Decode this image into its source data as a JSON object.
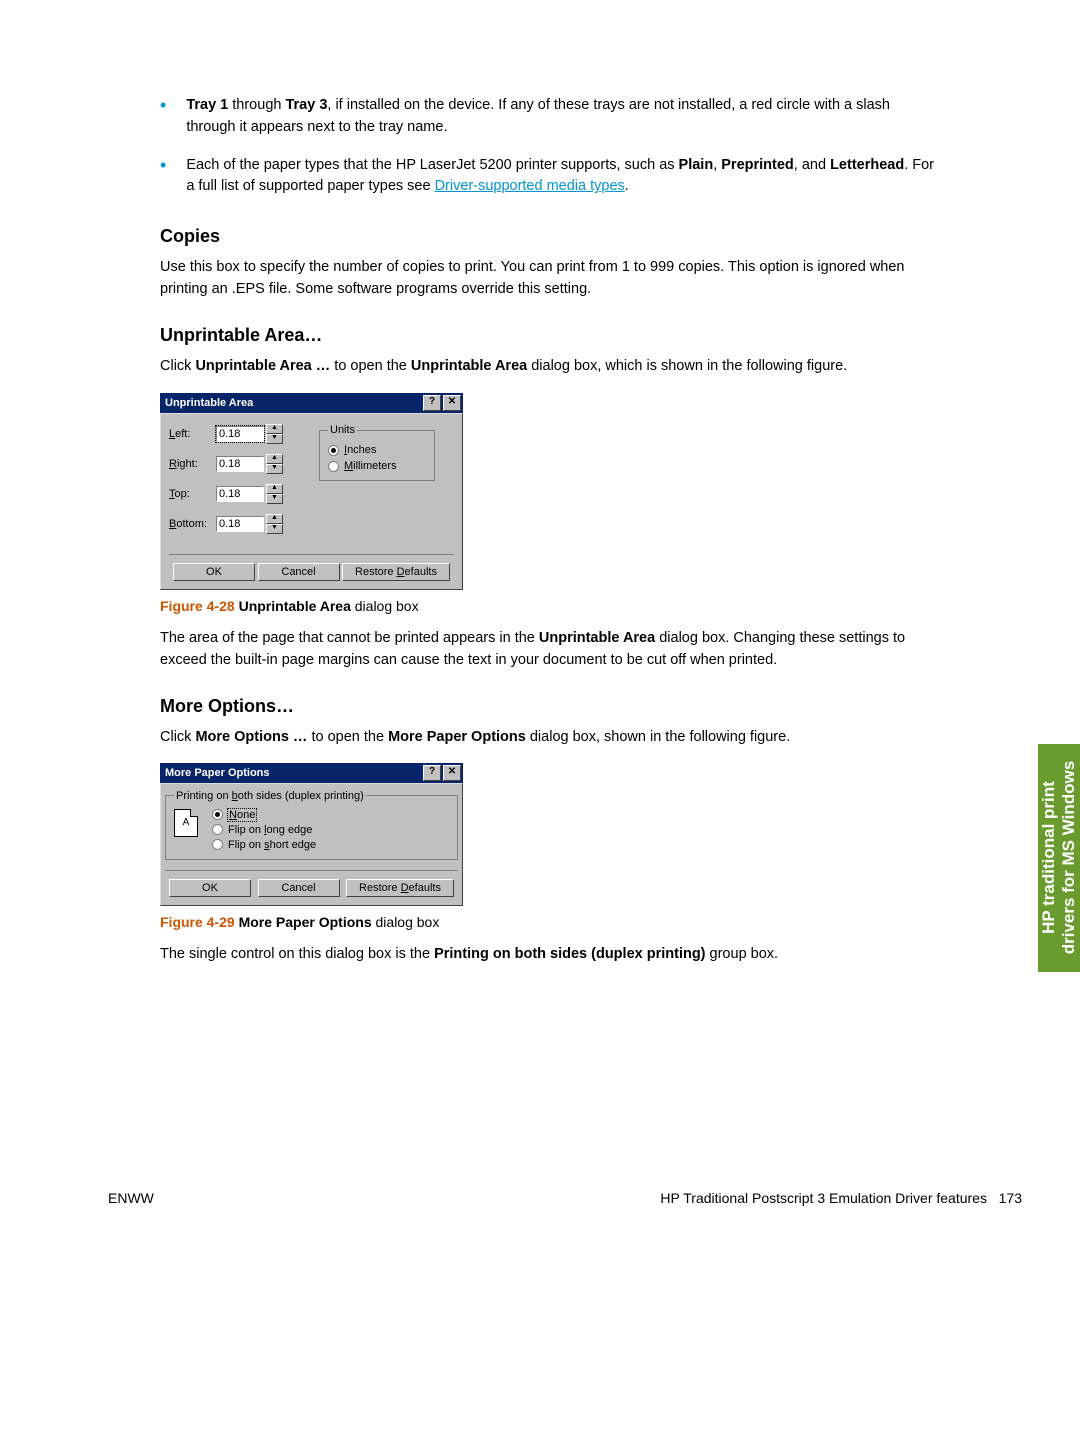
{
  "bullets": {
    "b1_pre": "Tray 1",
    "b1_mid": " through ",
    "b1_tr3": "Tray 3",
    "b1_rest": ", if installed on the device. If any of these trays are not installed, a red circle with a slash through it appears next to the tray name.",
    "b2_pre": "Each of the paper types that the HP LaserJet 5200 printer supports, such as ",
    "b2_plain": "Plain",
    "b2_c1": ", ",
    "b2_pre2": "Preprinted",
    "b2_c2": ", and ",
    "b2_lh": "Letterhead",
    "b2_after": ". For a full list of supported paper types see ",
    "b2_link": "Driver-supported media types",
    "b2_dot": "."
  },
  "copies": {
    "heading": "Copies",
    "text": "Use this box to specify the number of copies to print. You can print from 1 to 999 copies. This option is ignored when printing an .EPS file. Some software programs override this setting."
  },
  "ua": {
    "heading": "Unprintable Area…",
    "intro_pre": "Click ",
    "intro_b1": "Unprintable Area …",
    "intro_mid": " to open the ",
    "intro_b2": "Unprintable Area",
    "intro_post": " dialog box, which is shown in the following figure.",
    "dialog_title": "Unprintable Area",
    "labels": {
      "left": "Left:",
      "right": "Right:",
      "top": "Top:",
      "bottom": "Bottom:"
    },
    "values": {
      "left": "0.18",
      "right": "0.18",
      "top": "0.18",
      "bottom": "0.18"
    },
    "units_legend": "Units",
    "units_inches": "Inches",
    "units_mm": "Millimeters",
    "btn_ok": "OK",
    "btn_cancel": "Cancel",
    "btn_restore": "Restore Defaults",
    "fig_num": "Figure 4-28",
    "fig_title": "  Unprintable Area",
    "fig_suffix": "  dialog box",
    "para_pre": "The area of the page that cannot be printed appears in the ",
    "para_b": "Unprintable Area",
    "para_post": " dialog box. Changing these settings to exceed the built-in page margins can cause the text in your document to be cut off when printed."
  },
  "mo": {
    "heading": "More Options…",
    "intro_pre": "Click ",
    "intro_b1": "More Options …",
    "intro_mid": " to open the ",
    "intro_b2": "More Paper Options",
    "intro_post": " dialog box, shown in the following figure.",
    "dialog_title": "More Paper Options",
    "fs_legend": "Printing on both sides (duplex printing)",
    "opt_none": "None",
    "opt_long": "Flip on long edge",
    "opt_short": "Flip on short edge",
    "btn_ok": "OK",
    "btn_cancel": "Cancel",
    "btn_restore": "Restore Defaults",
    "fig_num": "Figure 4-29",
    "fig_title": "  More Paper Options",
    "fig_suffix": " dialog box",
    "final_pre": "The single control on this dialog box is the ",
    "final_b": "Printing on both sides (duplex printing)",
    "final_post": " group box."
  },
  "side_tab": {
    "line1": "HP traditional print",
    "line2": "drivers for MS Windows"
  },
  "footer": {
    "left": "ENWW",
    "right_text": "HP Traditional Postscript 3 Emulation Driver features",
    "pg": "173"
  }
}
